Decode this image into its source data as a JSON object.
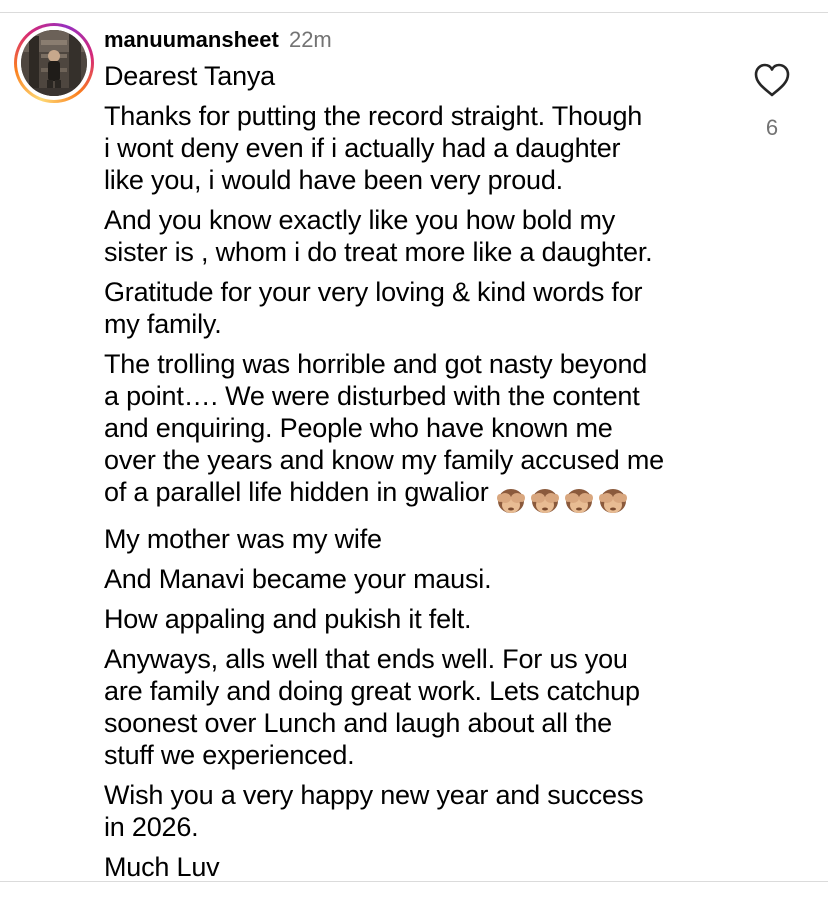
{
  "comment": {
    "username": "manuumansheet",
    "timestamp": "22m",
    "like_count": "6",
    "like_icon": "heart-outline-icon",
    "avatar_ring_colors": [
      "#feda75",
      "#fa7e1e",
      "#d62976",
      "#962fbf"
    ],
    "paragraphs": [
      "Dearest Tanya",
      "Thanks for putting the record straight. Though\ni wont deny even if i actually had a daughter\nlike you, i would have been very proud.",
      "And you know exactly like you how bold my\nsister is , whom i do treat more like a daughter.",
      "Gratitude for your very loving & kind words for\nmy family.",
      "The trolling was horrible and got nasty beyond\na point…. We were disturbed with the content\nand enquiring. People who have known me\nover the years and know my family accused me\nof a parallel life hidden in gwalior",
      "My mother was my wife",
      "And Manavi became your mausi.",
      "How appaling and pukish it felt.",
      "Anyways, alls well that ends well. For us you\nare family and doing great work. Lets catchup\nsoonest over Lunch and laugh about all the\nstuff we experienced.",
      "Wish you a very happy new year and success\nin 2026.",
      "Much Luv"
    ],
    "emoji": {
      "name": "see-no-evil-monkey-icon",
      "count": 4
    }
  },
  "colors": {
    "text": "#000000",
    "secondary_text": "#737373",
    "divider": "#dbdbdb",
    "background": "#ffffff"
  }
}
